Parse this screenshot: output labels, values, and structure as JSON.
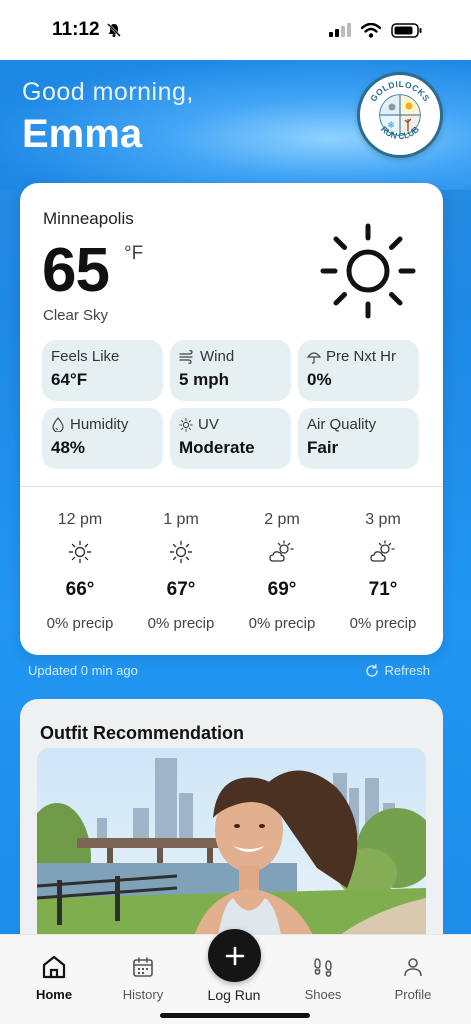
{
  "status_bar": {
    "time": "11:12"
  },
  "header": {
    "greeting": "Good morning,",
    "name": "Emma",
    "logo_text": "GOLDILOCKS RUN CLUB"
  },
  "weather": {
    "city": "Minneapolis",
    "temperature": "65",
    "unit": "°F",
    "condition": "Clear Sky",
    "icon": "sun-icon",
    "tiles": [
      {
        "label": "Feels Like",
        "value": "64°F",
        "icon": ""
      },
      {
        "label": "Wind",
        "value": "5 mph",
        "icon": "wind-icon"
      },
      {
        "label": "Pre Nxt Hr",
        "value": "0%",
        "icon": "umbrella-icon"
      },
      {
        "label": "Humidity",
        "value": "48%",
        "icon": "droplet-icon"
      },
      {
        "label": "UV",
        "value": "Moderate",
        "icon": "sun-icon"
      },
      {
        "label": "Air Quality",
        "value": "Fair",
        "icon": ""
      }
    ],
    "hourly": [
      {
        "time": "12 pm",
        "temp": "66°",
        "precip": "0% precip",
        "icon": "sun-icon"
      },
      {
        "time": "1 pm",
        "temp": "67°",
        "precip": "0% precip",
        "icon": "sun-icon"
      },
      {
        "time": "2 pm",
        "temp": "69°",
        "precip": "0% precip",
        "icon": "partly-cloudy-icon"
      },
      {
        "time": "3 pm",
        "temp": "71°",
        "precip": "0% precip",
        "icon": "partly-cloudy-icon"
      }
    ],
    "updated": "Updated 0 min ago",
    "refresh": "Refresh"
  },
  "outfit": {
    "title": "Outfit Recommendation"
  },
  "nav": {
    "items": [
      {
        "label": "Home",
        "icon": "home-icon"
      },
      {
        "label": "History",
        "icon": "calendar-icon"
      },
      {
        "label": "Log Run",
        "icon": "plus-icon"
      },
      {
        "label": "Shoes",
        "icon": "footprints-icon"
      },
      {
        "label": "Profile",
        "icon": "person-icon"
      }
    ]
  },
  "colors": {
    "accent": "#1e88e5",
    "tile_bg": "#e6f0f3",
    "dark_button": "#151515"
  }
}
